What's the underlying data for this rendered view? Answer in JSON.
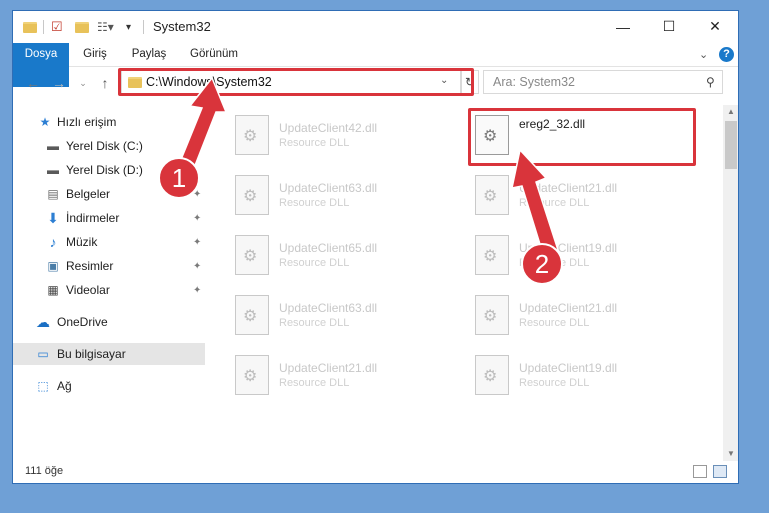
{
  "window": {
    "title": "System32",
    "controls": {
      "minimize": "—",
      "maximize": "☐",
      "close": "✕"
    }
  },
  "ribbon": {
    "tabs": [
      "Dosya",
      "Giriş",
      "Paylaş",
      "Görünüm"
    ],
    "help": "?"
  },
  "address": {
    "path": "C:\\Windows\\System32",
    "search_placeholder": "Ara: System32"
  },
  "nav": {
    "items": [
      {
        "label": "Hızlı erişim",
        "icon": "star-icon"
      },
      {
        "label": "Yerel Disk (C:)",
        "icon": "drive-icon"
      },
      {
        "label": "Yerel Disk (D:)",
        "icon": "drive-icon"
      },
      {
        "label": "Belgeler",
        "icon": "documents-icon"
      },
      {
        "label": "İndirmeler",
        "icon": "download-icon"
      },
      {
        "label": "Müzik",
        "icon": "music-icon"
      },
      {
        "label": "Resimler",
        "icon": "pictures-icon"
      },
      {
        "label": "Videolar",
        "icon": "video-icon"
      },
      {
        "label": "OneDrive",
        "icon": "cloud-icon"
      },
      {
        "label": "Bu bilgisayar",
        "icon": "computer-icon"
      },
      {
        "label": "Ağ",
        "icon": "network-icon"
      }
    ]
  },
  "files": {
    "left": [
      {
        "name": "UpdateClient42.dll",
        "type": "Resource DLL"
      },
      {
        "name": "UpdateClient63.dll",
        "type": "Resource DLL"
      },
      {
        "name": "UpdateClient65.dll",
        "type": "Resource DLL"
      },
      {
        "name": "UpdateClient63.dll",
        "type": "Resource DLL"
      },
      {
        "name": "UpdateClient21.dll",
        "type": "Resource DLL"
      }
    ],
    "right": [
      {
        "name": "ereg2_32.dll",
        "type": ""
      },
      {
        "name": "UpdateClient21.dll",
        "type": "Resource DLL"
      },
      {
        "name": "UpdateClient19.dll",
        "type": "Resource DLL"
      },
      {
        "name": "UpdateClient21.dll",
        "type": "Resource DLL"
      },
      {
        "name": "UpdateClient19.dll",
        "type": "Resource DLL"
      }
    ]
  },
  "status": {
    "count": "111 öğe"
  },
  "annotations": {
    "step1": "1",
    "step2": "2"
  },
  "colors": {
    "accent": "#1979ca",
    "highlight": "#d9343b",
    "desktop": "#6fa0d6"
  }
}
